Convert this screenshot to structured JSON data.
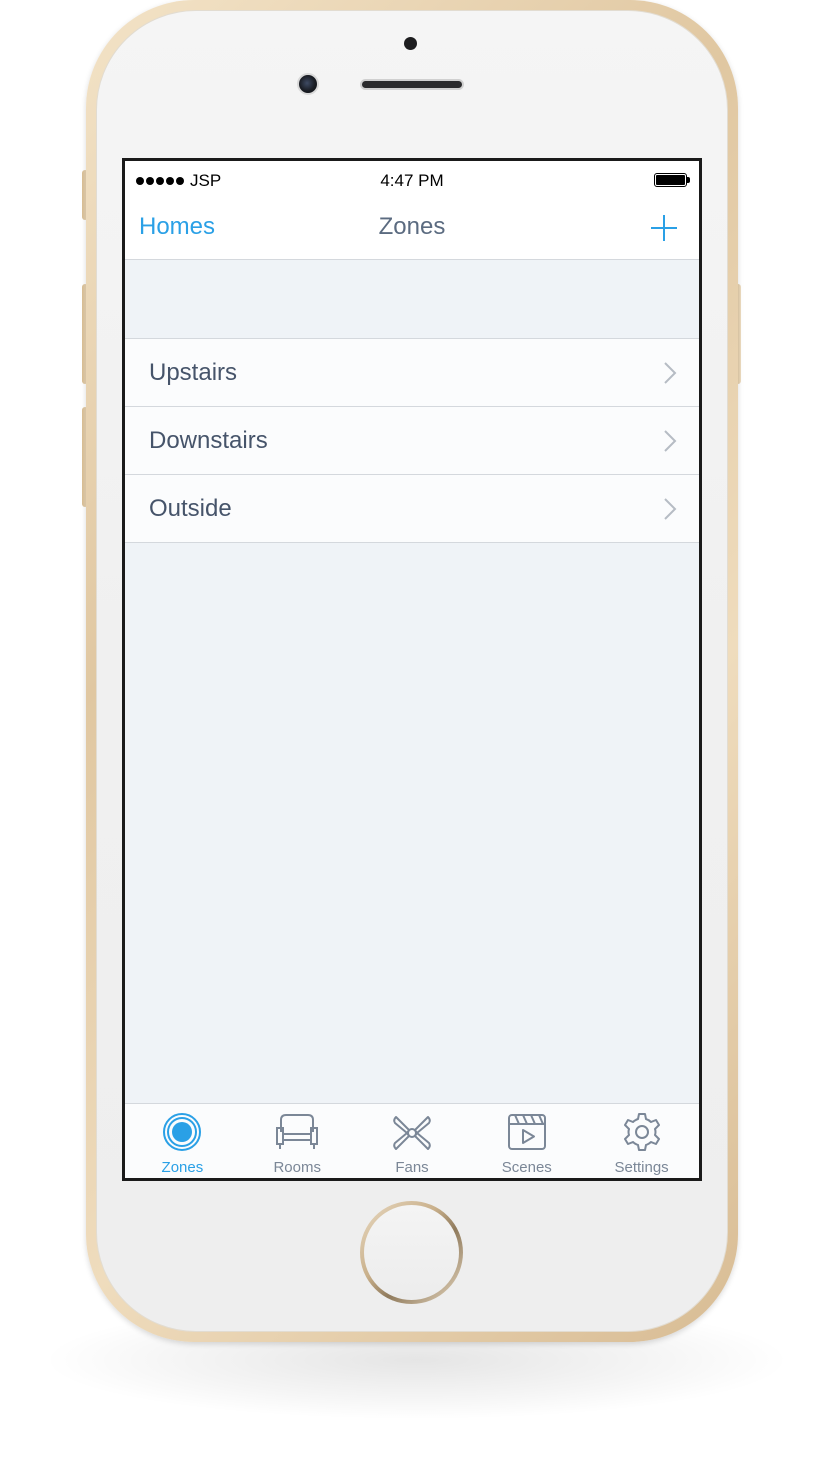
{
  "status_bar": {
    "carrier": "JSP",
    "time": "4:47 PM"
  },
  "nav": {
    "back_label": "Homes",
    "title": "Zones",
    "add_icon": "plus-icon"
  },
  "zones": [
    {
      "label": "Upstairs"
    },
    {
      "label": "Downstairs"
    },
    {
      "label": "Outside"
    }
  ],
  "tab_bar": {
    "tabs": [
      {
        "label": "Zones",
        "icon": "zones-icon",
        "active": true
      },
      {
        "label": "Rooms",
        "icon": "sofa-icon",
        "active": false
      },
      {
        "label": "Fans",
        "icon": "fan-icon",
        "active": false
      },
      {
        "label": "Scenes",
        "icon": "clapperboard-icon",
        "active": false
      },
      {
        "label": "Settings",
        "icon": "gear-icon",
        "active": false
      }
    ]
  },
  "colors": {
    "accent": "#2aa0e6",
    "title_text": "#5b6b80",
    "row_text": "#46546a",
    "inactive_tab": "#7b8797",
    "background": "#eff3f7"
  }
}
